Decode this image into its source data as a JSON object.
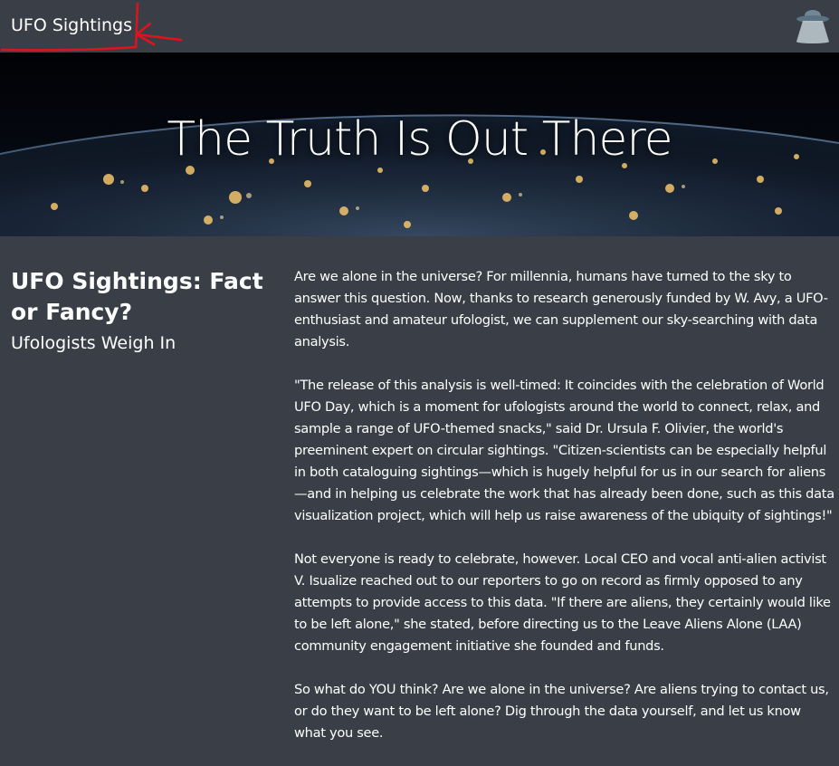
{
  "navbar": {
    "brand": "UFO Sightings",
    "icon": "ufo-icon"
  },
  "hero": {
    "title": "The Truth Is Out There"
  },
  "sidebar": {
    "headline": "UFO Sightings: Fact or Fancy?",
    "subheadline": "Ufologists Weigh In"
  },
  "article": {
    "paragraphs": [
      "Are we alone in the universe? For millennia, humans have turned to the sky to answer this question. Now, thanks to research generously funded by W. Avy, a UFO-enthusiast and amateur ufologist, we can supplement our sky-searching with data analysis.",
      "\"The release of this analysis is well-timed: It coincides with the celebration of World UFO Day, which is a moment for ufologists around the world to connect, relax, and sample a range of UFO-themed snacks,\" said Dr. Ursula F. Olivier, the world's preeminent expert on circular sightings. \"Citizen-scientists can be especially helpful in both cataloguing sightings—which is hugely helpful for us in our search for aliens—and in helping us celebrate the work that has already been done, such as this data visualization project, which will help us raise awareness of the ubiquity of sightings!\"",
      "Not everyone is ready to celebrate, however. Local CEO and vocal anti-alien activist V. Isualize reached out to our reporters to go on record as firmly opposed to any attempts to provide access to this data. \"If there are aliens, they certainly would like to be left alone,\" she stated, before directing us to the Leave Aliens Alone (LAA) community engagement initiative she founded and funds.",
      "So what do YOU think? Are we alone in the universe? Are aliens trying to contact us, or do they want to be left alone? Dig through the data yourself, and let us know what you see."
    ]
  },
  "colors": {
    "background": "#3a3f47",
    "text": "#ffffff",
    "annotation": "#e0131b"
  }
}
